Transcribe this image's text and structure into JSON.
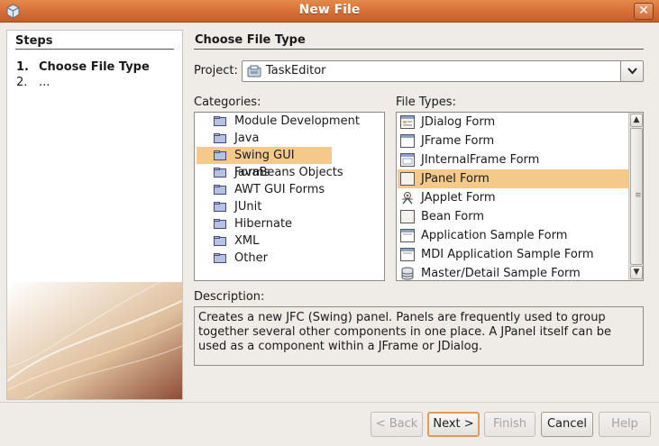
{
  "window": {
    "title": "New File",
    "close_label": "✕"
  },
  "steps": {
    "title": "Steps",
    "items": [
      {
        "num": "1.",
        "label": "Choose File Type"
      },
      {
        "num": "2.",
        "label": "..."
      }
    ]
  },
  "main": {
    "title": "Choose File Type",
    "project_label": "Project:",
    "project_value": "TaskEditor",
    "categories_label": "Categories:",
    "filetypes_label": "File Types:",
    "description_label": "Description:",
    "description": "Creates a new JFC (Swing) panel. Panels are frequently used to group together several other components in one place. A JPanel itself can be used as a component within a JFrame or JDialog."
  },
  "categories": [
    "Module Development",
    "Java",
    "Swing GUI Forms",
    "JavaBeans Objects",
    "AWT GUI Forms",
    "JUnit",
    "Hibernate",
    "XML",
    "Other"
  ],
  "selected_category": "Swing GUI Forms",
  "file_types": [
    {
      "label": "JDialog Form",
      "icon": "dialog-form-icon"
    },
    {
      "label": "JFrame Form",
      "icon": "frame-form-icon"
    },
    {
      "label": "JInternalFrame Form",
      "icon": "internal-frame-form-icon"
    },
    {
      "label": "JPanel Form",
      "icon": "panel-form-icon"
    },
    {
      "label": "JApplet Form",
      "icon": "applet-form-icon"
    },
    {
      "label": "Bean Form",
      "icon": "bean-form-icon"
    },
    {
      "label": "Application Sample Form",
      "icon": "application-form-icon"
    },
    {
      "label": "MDI Application Sample Form",
      "icon": "mdi-form-icon"
    },
    {
      "label": "Master/Detail Sample Form",
      "icon": "database-form-icon"
    }
  ],
  "selected_file_type": "JPanel Form",
  "buttons": {
    "back": "< Back",
    "next": "Next >",
    "finish": "Finish",
    "cancel": "Cancel",
    "help": "Help"
  },
  "colors": {
    "titlebar": "#d9733a",
    "selection": "#f5c98a",
    "default_button_border": "#e09a5a"
  }
}
